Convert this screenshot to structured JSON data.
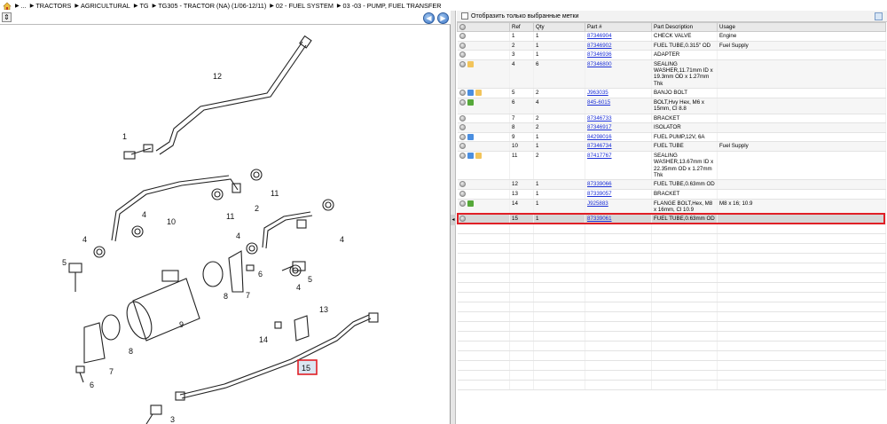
{
  "breadcrumb": [
    "...",
    "TRACTORS",
    "AGRICULTURAL",
    "TG",
    "TG305 - TRACTOR (NA) (1/06-12/11)",
    "02 - FUEL SYSTEM",
    "03 -03 - PUMP, FUEL TRANSFER"
  ],
  "filter": {
    "label": "Отобразить только выбранные метки"
  },
  "columns": [
    "Ref",
    "Qty",
    "Part #",
    "Part Description",
    "Usage"
  ],
  "rows": [
    {
      "ref": "1",
      "qty": "1",
      "part": "87346904",
      "desc": "CHECK VALVE",
      "usage": "Engine",
      "icons": [
        "info"
      ]
    },
    {
      "ref": "2",
      "qty": "1",
      "part": "87346902",
      "desc": "FUEL TUBE,0.315\" OD",
      "usage": "Fuel Supply",
      "icons": [
        "info"
      ]
    },
    {
      "ref": "3",
      "qty": "1",
      "part": "87346936",
      "desc": "ADAPTER",
      "usage": "",
      "icons": [
        "info"
      ]
    },
    {
      "ref": "4",
      "qty": "6",
      "part": "87346800",
      "desc": "SEALING WASHER,11.71mm ID x 19.3mm OD x 1.27mm Thk",
      "usage": "",
      "icons": [
        "info",
        "note"
      ]
    },
    {
      "ref": "5",
      "qty": "2",
      "part": "J963035",
      "desc": "BANJO BOLT",
      "usage": "",
      "icons": [
        "info",
        "swap",
        "note"
      ]
    },
    {
      "ref": "6",
      "qty": "4",
      "part": "845-6015",
      "desc": "BOLT,Hvy Hex, M6 x 15mm, Cl 8.8",
      "usage": "",
      "icons": [
        "info",
        "green"
      ]
    },
    {
      "ref": "7",
      "qty": "2",
      "part": "87346733",
      "desc": "BRACKET",
      "usage": "",
      "icons": [
        "info"
      ]
    },
    {
      "ref": "8",
      "qty": "2",
      "part": "87346917",
      "desc": "ISOLATOR",
      "usage": "",
      "icons": [
        "info"
      ]
    },
    {
      "ref": "9",
      "qty": "1",
      "part": "84298016",
      "desc": "FUEL PUMP,12V, 6A",
      "usage": "",
      "icons": [
        "info",
        "swap"
      ]
    },
    {
      "ref": "10",
      "qty": "1",
      "part": "87346734",
      "desc": "FUEL TUBE",
      "usage": "Fuel Supply",
      "icons": [
        "info"
      ]
    },
    {
      "ref": "11",
      "qty": "2",
      "part": "87417767",
      "desc": "SEALING WASHER,13.67mm ID x 22.35mm OD x 1.27mm Thk",
      "usage": "",
      "icons": [
        "info",
        "swap",
        "note"
      ]
    },
    {
      "ref": "12",
      "qty": "1",
      "part": "87339066",
      "desc": "FUEL TUBE,0.63mm OD",
      "usage": "",
      "icons": [
        "info"
      ]
    },
    {
      "ref": "13",
      "qty": "1",
      "part": "87339057",
      "desc": "BRACKET",
      "usage": "",
      "icons": [
        "info"
      ]
    },
    {
      "ref": "14",
      "qty": "1",
      "part": "J925883",
      "desc": "FLANGE BOLT,Hex, M8 x 16mm, Cl 10.9",
      "usage": "M8 x 16; 10.9",
      "icons": [
        "info",
        "green"
      ]
    },
    {
      "ref": "15",
      "qty": "1",
      "part": "87339061",
      "desc": "FUEL TUBE,0.63mm OD",
      "usage": "",
      "icons": [
        "info"
      ],
      "selected": true
    }
  ],
  "callouts": [
    "1",
    "2",
    "3",
    "4",
    "4",
    "4",
    "4",
    "4",
    "5",
    "5",
    "6",
    "6",
    "7",
    "7",
    "8",
    "8",
    "9",
    "10",
    "11",
    "11",
    "12",
    "13",
    "14",
    "15"
  ],
  "colors": {
    "selection": "#e01f26",
    "link": "#1b2fd6"
  }
}
